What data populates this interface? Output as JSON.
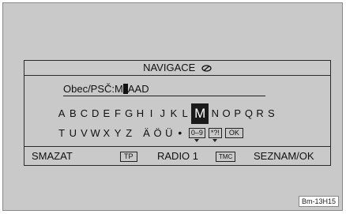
{
  "screen": {
    "title": "NAVIGACE",
    "title_icon": "navigation-icon",
    "entry": {
      "label": "Obec/PSČ:",
      "typed": "M",
      "pending": "AAD"
    },
    "keyboard": {
      "row1": [
        "A",
        "B",
        "C",
        "D",
        "E",
        "F",
        "G",
        "H",
        "I",
        "J",
        "K",
        "L",
        "M",
        "N",
        "O",
        "P",
        "Q",
        "R",
        "S"
      ],
      "selected": "M",
      "row2": [
        "T",
        "U",
        "V",
        "W",
        "X",
        "Y",
        "Z",
        "Ä",
        "Ö",
        "Ü"
      ],
      "special_dot": "•",
      "special_keys": [
        "0–9",
        "*?!",
        "OK"
      ]
    },
    "softkeys": {
      "delete": "SMAZAT",
      "tp": "TP",
      "radio": "RADIO 1",
      "tmc": "TMC",
      "list_ok": "SEZNAM/OK"
    }
  },
  "figure_id": "Bm-13H15"
}
